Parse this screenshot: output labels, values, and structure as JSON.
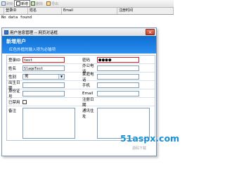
{
  "toolbar": {
    "btn1": "刷新",
    "btn2": "新增",
    "btn3": "删除",
    "btn4": "导出"
  },
  "grid": {
    "columns": [
      "登录ID",
      "姓名",
      "Email",
      "注册时间"
    ],
    "empty_text": "No data found"
  },
  "dialog": {
    "title": "用户信息管理 -- 网页对话框",
    "close": "×",
    "banner_title": "新增用户",
    "banner_subtitle": "红色外框的输入项为必输项",
    "form": {
      "login_label": "登录ID",
      "login_value": "test",
      "password_label": "密码",
      "password_value": "●●●●",
      "name_label": "姓名",
      "name_value": "SlaqeTest",
      "office_phone_label": "办公电话",
      "gender_label": "性别",
      "gender_value": "男",
      "home_phone_label": "家庭电话",
      "birthday_label": "出生日期",
      "mobile_label": "手机",
      "idcard_label": "身份证号",
      "email_label": "Email",
      "disabled_label": "已禁用",
      "register_label": "注册日期",
      "remark_label": "备注",
      "address_label": "通讯住址"
    }
  },
  "watermark": {
    "text": "51aspx.com",
    "sub": "源码下载"
  },
  "colors": {
    "banner": "#1a7fe0",
    "required_border": "#e02020",
    "watermark": "#1a8fd8"
  }
}
